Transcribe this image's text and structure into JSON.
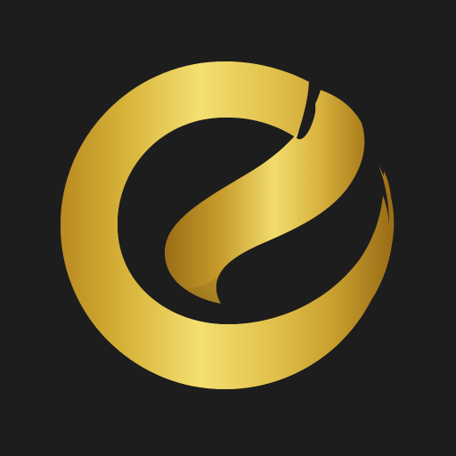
{
  "logo": {
    "icon": "gold-swirl-circle-logo-icon",
    "colors": {
      "background": "#1d1d1d",
      "gold_light": "#f4df71",
      "gold_mid": "#d8b43a",
      "gold_dark": "#b98a21",
      "gold_deep": "#9a6d16"
    }
  }
}
